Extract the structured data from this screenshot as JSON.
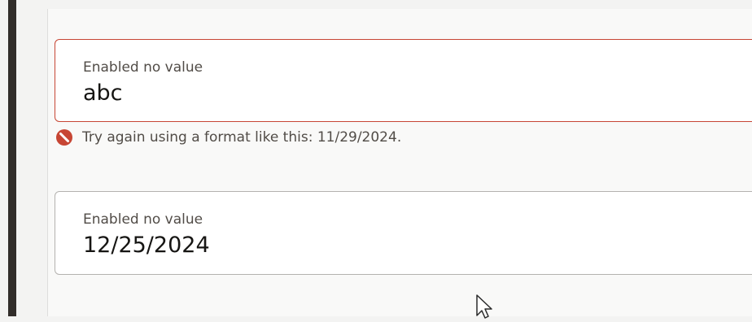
{
  "form": {
    "fields": [
      {
        "label": "Enabled no value",
        "value": "abc",
        "state": "error",
        "error_message": "Try again using a format like this: 11/29/2024."
      },
      {
        "label": "Enabled no value",
        "value": "12/25/2024",
        "state": "normal"
      }
    ]
  },
  "icons": {
    "error": "error-icon",
    "cursor": "mouse-pointer-icon"
  },
  "colors": {
    "error": "#c74634",
    "sidebar": "#312d2a",
    "border": "#b4b2af"
  }
}
